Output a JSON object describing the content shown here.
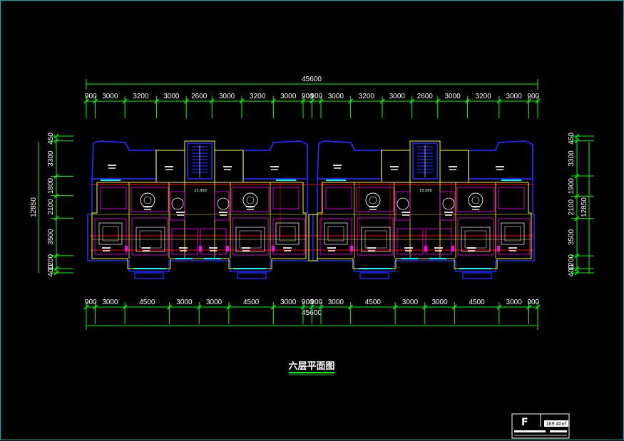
{
  "drawing": {
    "title": "六层平面图",
    "total_width": "45600",
    "total_depth": "12850",
    "top_segments": [
      "900",
      "3000",
      "3200",
      "3000",
      "2600",
      "3000",
      "3200",
      "3000",
      "900",
      "900",
      "3000",
      "3200",
      "3000",
      "2600",
      "3000",
      "3200",
      "3000",
      "900"
    ],
    "bottom_segments": [
      "900",
      "3000",
      "4500",
      "3000",
      "3000",
      "4500",
      "3000",
      "900",
      "900",
      "3000",
      "4500",
      "3000",
      "3000",
      "4500",
      "3000",
      "900"
    ],
    "left_segments": [
      "450",
      "3300",
      "1800",
      "2100",
      "3500",
      "1200",
      "400"
    ],
    "right_segments": [
      "450",
      "3300",
      "1900",
      "2100",
      "3500",
      "1200",
      "400"
    ],
    "stair_levels": [
      "15.000",
      "15.000"
    ],
    "colors": {
      "background": "#000000",
      "dimension": "#00ff00",
      "wall_outline": "#1e2aff",
      "wall_inner": "#ffff00",
      "room_line": "#ff00ff",
      "axis": "#ff0000",
      "furniture": "#ffffff",
      "frame": "#00b3b3"
    }
  },
  "title_block": {
    "letter": "F",
    "area": "169.40㎡"
  }
}
